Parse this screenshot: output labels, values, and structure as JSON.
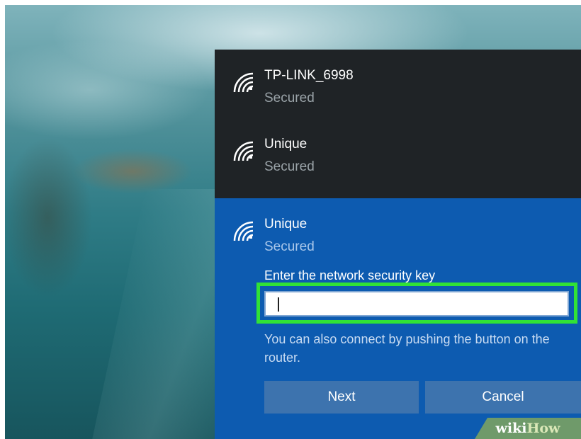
{
  "networks": [
    {
      "name": "TP-LINK_6998",
      "status": "Secured",
      "icon": "wifi-signal-icon"
    },
    {
      "name": "Unique",
      "status": "Secured",
      "icon": "wifi-signal-icon"
    },
    {
      "name": "Unique",
      "status": "Secured",
      "icon": "wifi-signal-icon",
      "selected": true
    }
  ],
  "connect": {
    "prompt": "Enter the network security key",
    "key_value": "",
    "hint": "You can also connect by pushing the button on the router.",
    "next_label": "Next",
    "cancel_label": "Cancel"
  },
  "watermark": {
    "part1": "wiki",
    "part2": "How"
  },
  "colors": {
    "panel_bg": "#1f2326",
    "selected_bg": "#0d5bb0",
    "button_bg": "#3d73ae",
    "highlight": "#31e236"
  }
}
